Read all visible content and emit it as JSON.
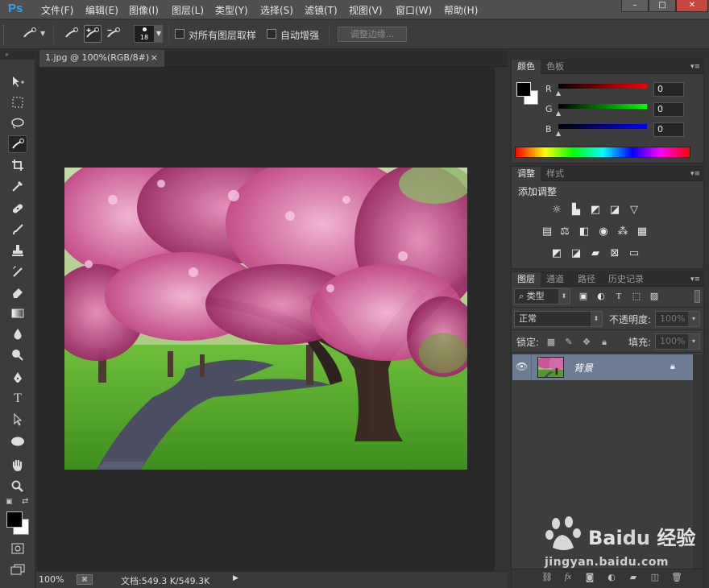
{
  "app": {
    "logo": "Ps"
  },
  "menu": [
    "文件(F)",
    "编辑(E)",
    "图像(I)",
    "图层(L)",
    "类型(Y)",
    "选择(S)",
    "滤镜(T)",
    "视图(V)",
    "窗口(W)",
    "帮助(H)"
  ],
  "window_controls": {
    "minimize": "–",
    "maximize": "□",
    "close": "✕"
  },
  "options": {
    "brush_size": "18",
    "sample_all_layers": "对所有图层取样",
    "auto_enhance": "自动增强",
    "refine_edge": "调整边缘..."
  },
  "document": {
    "tab_title": "1.jpg @ 100%(RGB/8#)",
    "tab_close": "×",
    "zoom": "100%",
    "doc_info": "文档:549.3 K/549.3K"
  },
  "color_panel": {
    "tabs": [
      "颜色",
      "色板"
    ],
    "r_label": "R",
    "g_label": "G",
    "b_label": "B",
    "r": "0",
    "g": "0",
    "b": "0",
    "foreground": "#000000",
    "background": "#ffffff"
  },
  "adjust_panel": {
    "tabs": [
      "调整",
      "样式"
    ],
    "add_adjustment": "添加调整"
  },
  "layers_panel": {
    "tabs": [
      "图层",
      "通道",
      "路径",
      "历史记录"
    ],
    "filter_kind": "类型",
    "blend_mode": "正常",
    "opacity_label": "不透明度:",
    "opacity_value": "100%",
    "lock_label": "锁定:",
    "fill_label": "填充:",
    "fill_value": "100%",
    "layers": [
      {
        "name": "背景",
        "visible": true,
        "locked": true
      }
    ]
  },
  "watermark": {
    "url": "jingyan.baidu.com"
  },
  "colors": {
    "accent": "#2fa3f7",
    "layer_selected": "#6b7c93"
  }
}
